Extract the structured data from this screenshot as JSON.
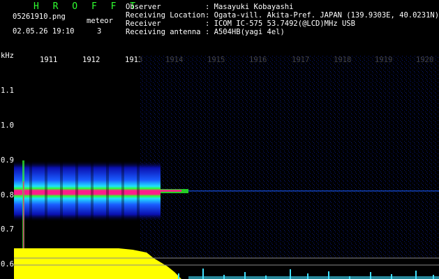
{
  "header": {
    "logo": "H R O F F T",
    "filename": "05261910.png",
    "timestamp": "02.05.26 19:10",
    "meteor_label": "meteor",
    "meteor_count": "3",
    "info": [
      {
        "label": "Observer",
        "value": ": Masayuki Kobayashi"
      },
      {
        "label": "Receiving Location",
        "value": ": Ogata-vill. Akita-Pref. JAPAN (139.9303E, 40.0231N)"
      },
      {
        "label": "Receiver",
        "value": ": ICOM IC-575 53.7492(@LCD)MHz USB"
      },
      {
        "label": "Receiving antenna",
        "value": ": A504HB(yagi 4el)"
      }
    ]
  },
  "axes": {
    "y_unit": "kHz",
    "y_ticks": [
      "1.1",
      "1.0",
      "0.9",
      "0.8",
      "0.7",
      "0.6"
    ],
    "x_ticks": [
      "1911",
      "1912",
      "1913",
      "1914",
      "1915",
      "1916",
      "1917",
      "1918",
      "1919",
      "1920"
    ]
  },
  "colors": {
    "signal_core": "#ff1c8c",
    "signal_mid": "#2dff2d",
    "signal_edge": "#0a2cff",
    "bottom_bar": "#ffff00",
    "bottom_noise": "#40e0ff"
  }
}
